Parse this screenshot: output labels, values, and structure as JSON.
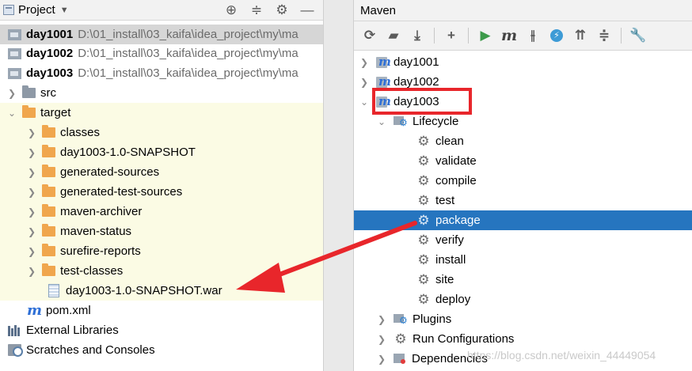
{
  "project": {
    "title": "Project",
    "rows": [
      {
        "name": "day1001",
        "path": "D:\\01_install\\03_kaifa\\idea_project\\my\\ma"
      },
      {
        "name": "day1002",
        "path": "D:\\01_install\\03_kaifa\\idea_project\\my\\ma"
      },
      {
        "name": "day1003",
        "path": "D:\\01_install\\03_kaifa\\idea_project\\my\\ma"
      }
    ],
    "src": "src",
    "target": "target",
    "target_children": [
      "classes",
      "day1003-1.0-SNAPSHOT",
      "generated-sources",
      "generated-test-sources",
      "maven-archiver",
      "maven-status",
      "surefire-reports",
      "test-classes"
    ],
    "war_file": "day1003-1.0-SNAPSHOT.war",
    "pom": "pom.xml",
    "external_libraries": "External Libraries",
    "scratches": "Scratches and Consoles"
  },
  "maven": {
    "title": "Maven",
    "modules": [
      "day1001",
      "day1002",
      "day1003"
    ],
    "lifecycle": "Lifecycle",
    "goals": [
      "clean",
      "validate",
      "compile",
      "test",
      "package",
      "verify",
      "install",
      "site",
      "deploy"
    ],
    "selected_goal": "package",
    "plugins": "Plugins",
    "run_configurations": "Run Configurations",
    "dependencies": "Dependencies"
  },
  "watermark": "https://blog.csdn.net/weixin_44449054",
  "colors": {
    "selection": "#2675bf",
    "highlight": "#fbfbe4",
    "annotation_red": "#e8262b",
    "folder_orange": "#f0a64d"
  }
}
